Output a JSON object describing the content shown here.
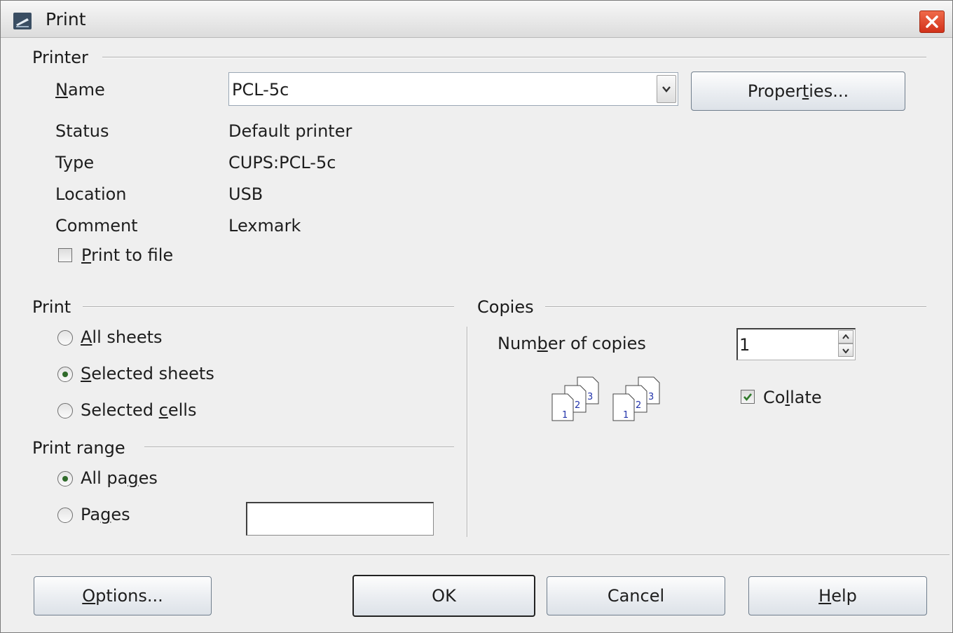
{
  "window": {
    "title": "Print",
    "close_icon": "close-icon",
    "app_icon": "printer-app-icon"
  },
  "printer": {
    "section_title": "Printer",
    "name_label": "Name",
    "name_value": "PCL-5c",
    "properties_button": "Properties...",
    "status_label": "Status",
    "status_value": "Default printer",
    "type_label": "Type",
    "type_value": "CUPS:PCL-5c",
    "location_label": "Location",
    "location_value": "USB",
    "comment_label": "Comment",
    "comment_value": "Lexmark",
    "print_to_file_label": "Print to file",
    "print_to_file_checked": false
  },
  "print": {
    "section_title": "Print",
    "options": [
      {
        "label": "All sheets",
        "checked": false
      },
      {
        "label": "Selected sheets",
        "checked": true
      },
      {
        "label": "Selected cells",
        "checked": false
      }
    ]
  },
  "print_range": {
    "section_title": "Print range",
    "options": [
      {
        "label": "All pages",
        "checked": true
      },
      {
        "label": "Pages",
        "checked": false
      }
    ],
    "pages_value": ""
  },
  "copies": {
    "section_title": "Copies",
    "number_label": "Number of copies",
    "number_value": "1",
    "collate_label": "Collate",
    "collate_checked": true,
    "page_icon_numbers": [
      "1",
      "2",
      "3"
    ]
  },
  "buttons": {
    "options": "Options...",
    "ok": "OK",
    "cancel": "Cancel",
    "help": "Help"
  }
}
